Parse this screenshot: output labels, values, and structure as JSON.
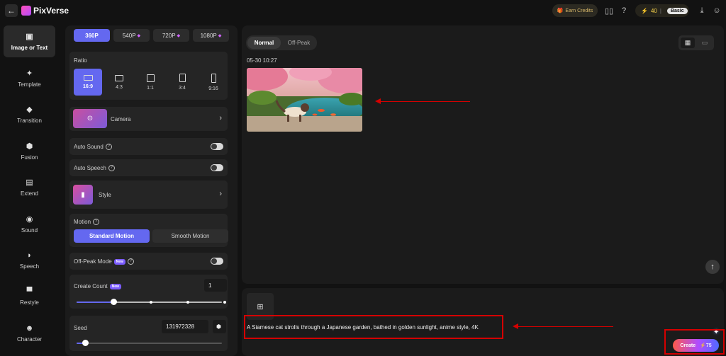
{
  "header": {
    "back_icon": "arrow-left-icon",
    "brand": "PixVerse",
    "earn_credits": "Earn Credits",
    "credits": "40",
    "plan": "Basic"
  },
  "nav": {
    "items": [
      {
        "label": "Image or Text",
        "icon": "image-icon",
        "glyph": "▣",
        "active": true
      },
      {
        "label": "Template",
        "icon": "sparkle-icon",
        "glyph": "✦"
      },
      {
        "label": "Transition",
        "icon": "transition-icon",
        "glyph": "◆"
      },
      {
        "label": "Fusion",
        "icon": "cube-icon",
        "glyph": "⬢"
      },
      {
        "label": "Extend",
        "icon": "extend-icon",
        "glyph": "▤"
      },
      {
        "label": "Sound",
        "icon": "sound-icon",
        "glyph": "◉"
      },
      {
        "label": "Speech",
        "icon": "lips-icon",
        "glyph": "◗"
      },
      {
        "label": "Restyle",
        "icon": "paint-roller-icon",
        "glyph": "▀"
      },
      {
        "label": "Character",
        "icon": "face-icon",
        "glyph": "☻"
      }
    ]
  },
  "settings": {
    "resolutions": [
      "360P",
      "540P",
      "720P",
      "1080P"
    ],
    "ratio_label": "Ratio",
    "ratios": [
      "16:9",
      "4:3",
      "1:1",
      "3:4",
      "9:16"
    ],
    "camera_label": "Camera",
    "auto_sound_label": "Auto Sound",
    "auto_speech_label": "Auto Speech",
    "style_label": "Style",
    "motion_label": "Motion",
    "standard_motion": "Standard Motion",
    "smooth_motion": "Smooth Motion",
    "off_peak_label": "Off-Peak Mode",
    "new_badge": "New",
    "create_count_label": "Create Count",
    "create_count_value": "1",
    "seed_label": "Seed",
    "seed_value": "131972328"
  },
  "main": {
    "modes": [
      "Normal",
      "Off-Peak"
    ],
    "date": "05-30 10:27"
  },
  "prompt": {
    "text": "A Siamese cat strolls through a Japanese garden, bathed in golden sunlight, anime style, 4K",
    "create_label": "Create",
    "create_cost": "⚡75"
  },
  "colors": {
    "accent": "#6468f0",
    "annotation": "#d50000"
  }
}
